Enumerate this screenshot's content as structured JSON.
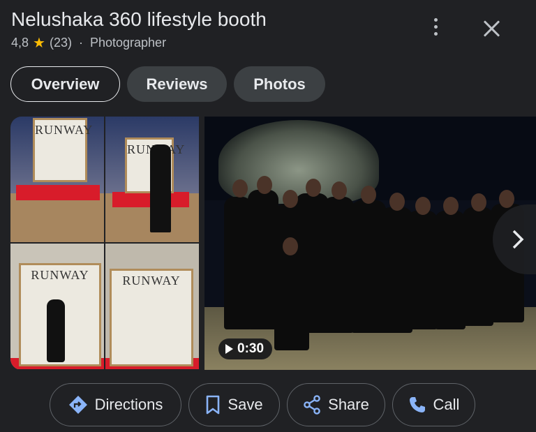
{
  "header": {
    "title": "Nelushaka 360 lifestyle booth",
    "rating": "4,8",
    "review_count": "(23)",
    "separator": "·",
    "category": "Photographer"
  },
  "tabs": [
    {
      "label": "Overview",
      "active": true
    },
    {
      "label": "Reviews",
      "active": false
    },
    {
      "label": "Photos",
      "active": false
    }
  ],
  "gallery": {
    "board_brand": "RUNWAY",
    "video_duration": "0:30"
  },
  "actions": [
    {
      "label": "Directions",
      "icon": "directions-icon"
    },
    {
      "label": "Save",
      "icon": "bookmark-icon"
    },
    {
      "label": "Share",
      "icon": "share-icon"
    },
    {
      "label": "Call",
      "icon": "phone-icon"
    }
  ],
  "colors": {
    "background": "#202124",
    "accent": "#8ab4f8",
    "star": "#fbbc04"
  }
}
